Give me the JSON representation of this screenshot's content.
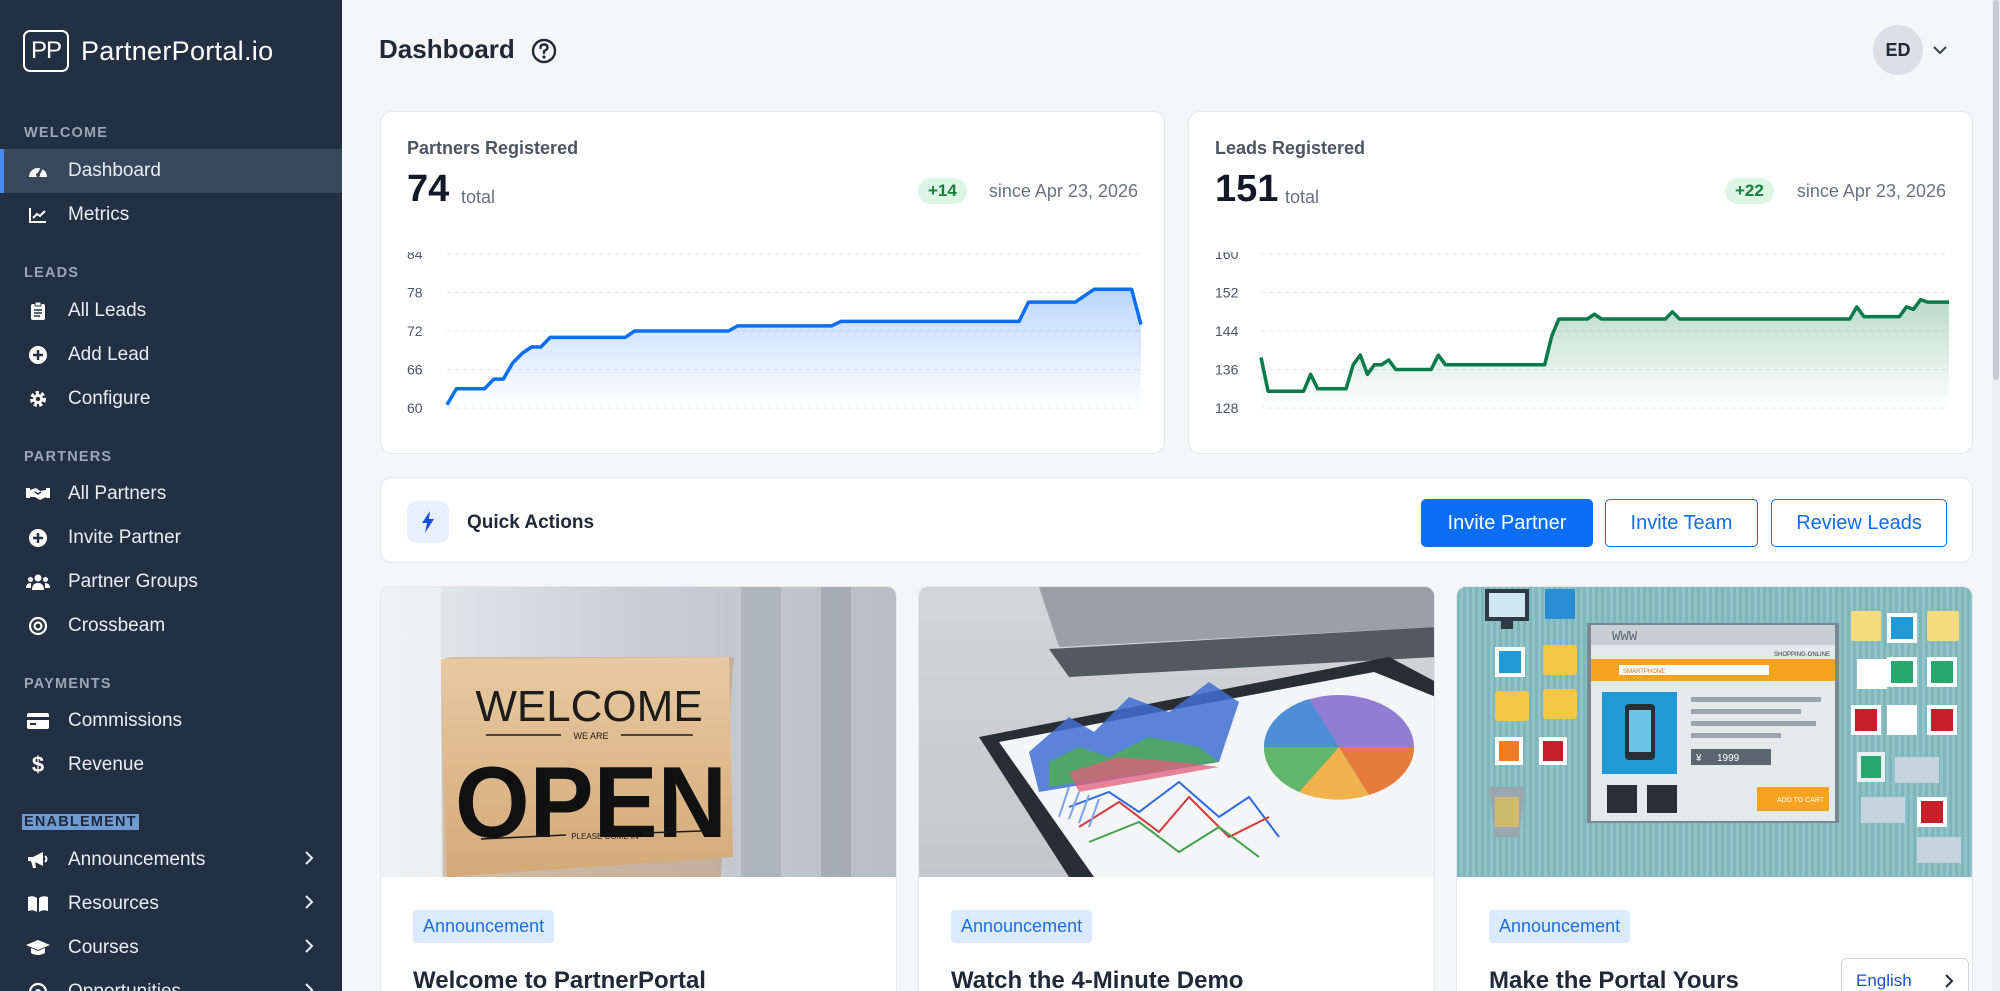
{
  "brand": {
    "logo": "PP",
    "name": "PartnerPortal.io"
  },
  "sidebar": {
    "sections": [
      {
        "label": "WELCOME",
        "items": [
          {
            "label": "Dashboard",
            "icon": "gauge-icon",
            "active": true
          },
          {
            "label": "Metrics",
            "icon": "line-chart-icon"
          }
        ]
      },
      {
        "label": "LEADS",
        "items": [
          {
            "label": "All Leads",
            "icon": "clipboard-icon"
          },
          {
            "label": "Add Lead",
            "icon": "plus-circle-icon"
          },
          {
            "label": "Configure",
            "icon": "gear-icon"
          }
        ]
      },
      {
        "label": "PARTNERS",
        "items": [
          {
            "label": "All Partners",
            "icon": "handshake-icon"
          },
          {
            "label": "Invite Partner",
            "icon": "plus-circle-icon"
          },
          {
            "label": "Partner Groups",
            "icon": "users-icon"
          },
          {
            "label": "Crossbeam",
            "icon": "crossbeam-icon"
          }
        ]
      },
      {
        "label": "PAYMENTS",
        "items": [
          {
            "label": "Commissions",
            "icon": "credit-card-icon"
          },
          {
            "label": "Revenue",
            "icon": "dollar-icon"
          }
        ]
      },
      {
        "label": "ENABLEMENT",
        "items": [
          {
            "label": "Announcements",
            "icon": "megaphone-icon"
          },
          {
            "label": "Resources",
            "icon": "book-icon"
          },
          {
            "label": "Courses",
            "icon": "graduation-cap-icon"
          },
          {
            "label": "Opportunities",
            "icon": "target-icon"
          }
        ]
      }
    ]
  },
  "header": {
    "title": "Dashboard",
    "user_initials": "ED"
  },
  "stats": [
    {
      "title": "Partners Registered",
      "value": "74",
      "unit": "total",
      "delta": "+14",
      "since": "since Apr 23, 2026",
      "color": "#0b6ef5"
    },
    {
      "title": "Leads Registered",
      "value": "151",
      "unit": "total",
      "delta": "+22",
      "since": "since Apr 23, 2026",
      "color": "#0a7a4b"
    }
  ],
  "chart_data": [
    {
      "type": "area",
      "title": "Partners Registered",
      "yticks": [
        "84",
        "78",
        "72",
        "66",
        "60"
      ],
      "ylim": [
        60,
        84
      ],
      "values": [
        60.5,
        63,
        63,
        63,
        63,
        64.5,
        64.5,
        67,
        68.5,
        69.5,
        69.5,
        71,
        71,
        71,
        71,
        71,
        71,
        71,
        71,
        71,
        72,
        72,
        72,
        72,
        72,
        72,
        72,
        72,
        72,
        72,
        72,
        72.8,
        72.8,
        72.8,
        72.8,
        72.8,
        72.8,
        72.8,
        72.8,
        72.8,
        72.8,
        72.8,
        73.5,
        73.5,
        73.5,
        73.5,
        73.5,
        73.5,
        73.5,
        73.5,
        73.5,
        73.5,
        73.5,
        73.5,
        73.5,
        73.5,
        73.5,
        73.5,
        73.5,
        73.5,
        73.5,
        73.5,
        76.5,
        76.5,
        76.5,
        76.5,
        76.5,
        76.5,
        77.5,
        78.5,
        78.5,
        78.5,
        78.5,
        78.5,
        73
      ]
    },
    {
      "type": "area",
      "title": "Leads Registered",
      "yticks": [
        "160",
        "152",
        "144",
        "136",
        "128"
      ],
      "ylim": [
        128,
        160
      ],
      "values": [
        138.5,
        131.5,
        131.5,
        131.5,
        131.5,
        131.5,
        131.5,
        135,
        132,
        132,
        132,
        132,
        132,
        137,
        139,
        135,
        137,
        137,
        138,
        136,
        136,
        136,
        136,
        136,
        136,
        139,
        137,
        137,
        137,
        137,
        137,
        137,
        137,
        137,
        137,
        137,
        137,
        137,
        137,
        137,
        137,
        143,
        146.5,
        146.5,
        146.5,
        146.5,
        146.5,
        147.5,
        146.5,
        146.5,
        146.5,
        146.5,
        146.5,
        146.5,
        146.5,
        146.5,
        146.5,
        146.5,
        148,
        146.5,
        146.5,
        146.5,
        146.5,
        146.5,
        146.5,
        146.5,
        146.5,
        146.5,
        146.5,
        146.5,
        146.5,
        146.5,
        146.5,
        146.5,
        146.5,
        146.5,
        146.5,
        146.5,
        146.5,
        146.5,
        146.5,
        146.5,
        146.5,
        146.5,
        149,
        147,
        147,
        147,
        147,
        147,
        147,
        149,
        148.5,
        150.5,
        150,
        150,
        150,
        150
      ]
    }
  ],
  "quick_actions": {
    "title": "Quick Actions",
    "buttons": [
      "Invite Partner",
      "Invite Team",
      "Review Leads"
    ]
  },
  "content_cards": [
    {
      "badge": "Announcement",
      "title": "Welcome to PartnerPortal",
      "sign_top": "WELCOME",
      "sign_mid": "WE ARE",
      "sign_main": "OPEN",
      "sign_bottom": "PLEASE COME IN"
    },
    {
      "badge": "Announcement",
      "title": "Watch the 4-Minute Demo"
    },
    {
      "badge": "Announcement",
      "title": "Make the Portal Yours",
      "window_label": "WWW",
      "tab_label": "SHOPPING-ONLINE",
      "search_label": "SMARTPHONE",
      "price": "1999",
      "currency": "¥",
      "cart_label": "ADD TO CART"
    }
  ],
  "language": "English"
}
